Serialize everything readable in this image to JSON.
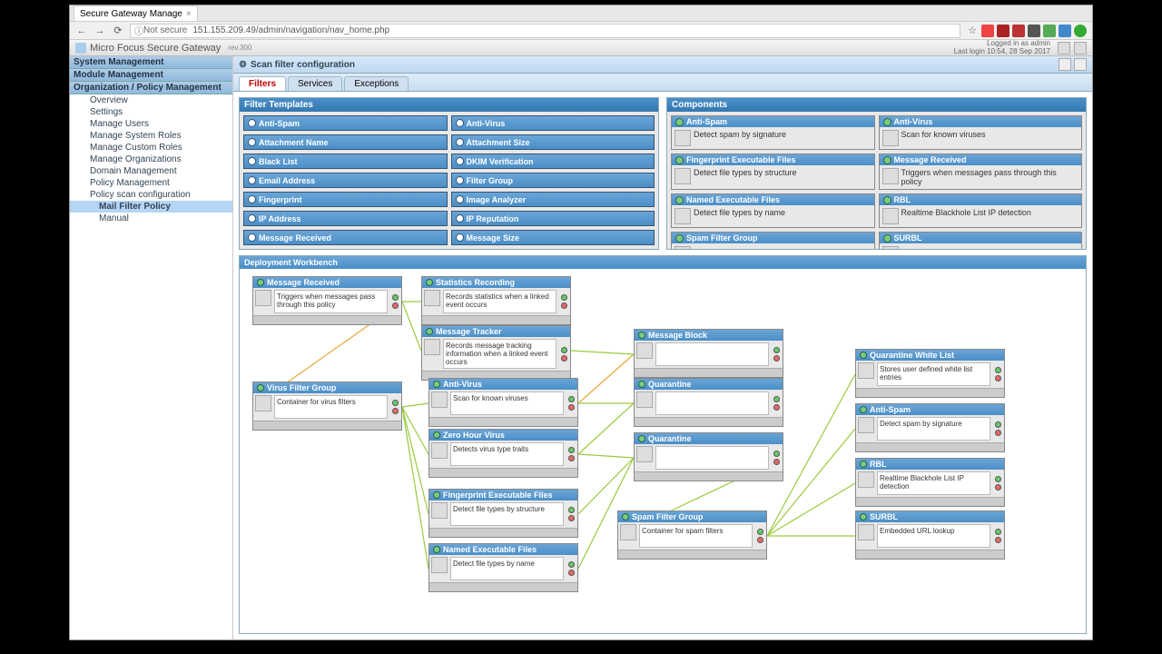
{
  "browser": {
    "tab_title": "Secure Gateway Manage",
    "addr_warning": "Not secure",
    "url": "151.155.209.49/admin/navigation/nav_home.php"
  },
  "header": {
    "product": "Micro Focus Secure Gateway",
    "version": "rev.300",
    "login_line1": "Logged in as admin",
    "login_line2": "Last login 10:54, 28 Sep 2017"
  },
  "sidebar": {
    "sections": [
      "System Management",
      "Module Management",
      "Organization / Policy Management"
    ],
    "items": [
      "Overview",
      "Settings",
      "Manage Users",
      "Manage System Roles",
      "Manage Custom Roles",
      "Manage Organizations",
      "Domain Management",
      "Policy Management",
      "Policy scan configuration",
      "Mail Filter Policy",
      "Manual"
    ]
  },
  "content": {
    "title": "Scan filter configuration"
  },
  "tabs": [
    "Filters",
    "Services",
    "Exceptions"
  ],
  "templates_panel": {
    "title": "Filter   Templates",
    "left": [
      "Anti-Spam",
      "Attachment Name",
      "Black List",
      "Email Address",
      "Fingerprint",
      "IP Address",
      "Message Received"
    ],
    "right": [
      "Anti-Virus",
      "Attachment Size",
      "DKIM Verification",
      "Filter Group",
      "Image Analyzer",
      "IP Reputation",
      "Message Size"
    ]
  },
  "components_panel": {
    "title": "Components",
    "items": [
      {
        "name": "Anti-Spam",
        "desc": "Detect spam by signature"
      },
      {
        "name": "Anti-Virus",
        "desc": "Scan for known viruses"
      },
      {
        "name": "Fingerprint Executable Files",
        "desc": "Detect file types by structure"
      },
      {
        "name": "Message Received",
        "desc": "Triggers when messages pass through this policy"
      },
      {
        "name": "Named Executable Files",
        "desc": "Detect file types by name"
      },
      {
        "name": "RBL",
        "desc": "Realtime Blackhole List IP detection"
      },
      {
        "name": "Spam Filter Group",
        "desc": ""
      },
      {
        "name": "SURBL",
        "desc": ""
      }
    ]
  },
  "workbench": {
    "title": "Deployment Workbench",
    "nodes": {
      "msg_received": {
        "title": "Message Received",
        "desc": "Triggers when messages pass through this policy"
      },
      "stats": {
        "title": "Statistics Recording",
        "desc": "Records statistics when a linked event occurs"
      },
      "tracker": {
        "title": "Message Tracker",
        "desc": "Records message tracking information when a linked event occurs"
      },
      "virus_group": {
        "title": "Virus Filter Group",
        "desc": "Container for virus filters"
      },
      "anti_virus": {
        "title": "Anti-Virus",
        "desc": "Scan for known viruses"
      },
      "zero_hour": {
        "title": "Zero Hour Virus",
        "desc": "Detects virus type traits"
      },
      "fingerprint": {
        "title": "Fingerprint Executable Files",
        "desc": "Detect file types by structure"
      },
      "named_exec": {
        "title": "Named Executable Files",
        "desc": "Detect file types by name"
      },
      "msg_block": {
        "title": "Message Block",
        "desc": ""
      },
      "quarantine1": {
        "title": "Quarantine",
        "desc": ""
      },
      "quarantine2": {
        "title": "Quarantine",
        "desc": ""
      },
      "spam_group": {
        "title": "Spam Filter Group",
        "desc": "Container for spam filters"
      },
      "q_whitelist": {
        "title": "Quarantine White List",
        "desc": "Stores user defined white list entries"
      },
      "anti_spam": {
        "title": "Anti-Spam",
        "desc": "Detect spam by signature"
      },
      "rbl": {
        "title": "RBL",
        "desc": "Realtime Blackhole List IP detection"
      },
      "surbl": {
        "title": "SURBL",
        "desc": "Embedded URL lookup"
      }
    }
  }
}
